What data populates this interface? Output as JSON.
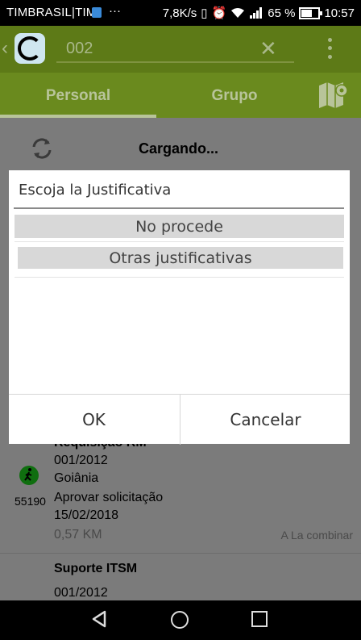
{
  "status_bar": {
    "carrier": "TIMBRASIL|TIM",
    "dots": "···",
    "speed": "7,8K/s",
    "battery": "65 %",
    "time": "10:57"
  },
  "app_bar": {
    "search_value": "002",
    "clear_icon": "close-icon",
    "menu_icon": "overflow-menu-icon"
  },
  "tabs": {
    "personal": "Personal",
    "grupo": "Grupo",
    "map_icon": "map-pin-icon"
  },
  "list": {
    "loading": "Cargando...",
    "item1": {
      "title": "Requisição RM",
      "code": "001/2012",
      "city": "Goiânia",
      "action": "Aprovar solicitação",
      "date": "15/02/2018",
      "distance": "0,57 KM",
      "number": "55190",
      "note": "A La combinar"
    },
    "item2": {
      "title": "Suporte ITSM",
      "code": "001/2012"
    }
  },
  "dialog": {
    "title": "Escoja la Justificativa",
    "options": [
      "No procede",
      "Otras justificativas"
    ],
    "ok": "OK",
    "cancel": "Cancelar"
  }
}
